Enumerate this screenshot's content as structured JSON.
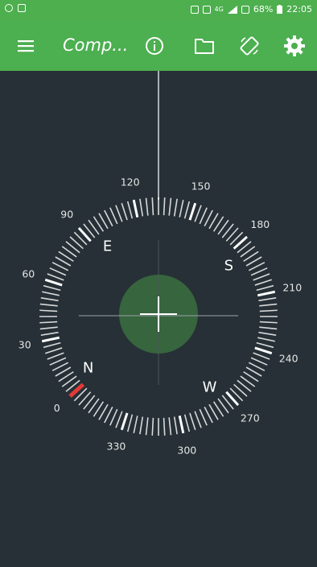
{
  "status_bar": {
    "battery": "68%",
    "time": "22:05",
    "network": "4G"
  },
  "toolbar": {
    "title": "Comp...",
    "icons": [
      "menu-icon",
      "info-icon",
      "folder-icon",
      "screen-rotation-icon",
      "gear-icon"
    ]
  },
  "compass": {
    "degree_labels": [
      "0",
      "30",
      "60",
      "90",
      "120",
      "150",
      "180",
      "210",
      "240",
      "270",
      "300",
      "330"
    ],
    "directions": [
      "N",
      "E",
      "S",
      "W"
    ],
    "colors": {
      "accent": "#4caf50",
      "background": "#263036",
      "north_marker": "#e53935",
      "ticks": "#ffffff"
    }
  }
}
